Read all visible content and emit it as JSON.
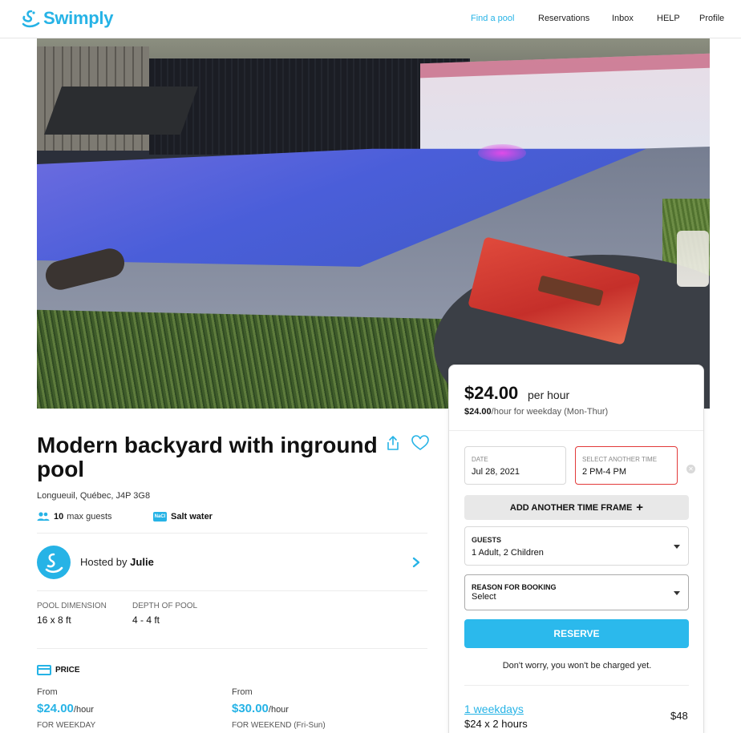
{
  "brand": {
    "name": "Swimply",
    "color": "#26b3e6"
  },
  "nav": {
    "items": [
      {
        "label": "Find a pool",
        "active": true
      },
      {
        "label": "Reservations"
      },
      {
        "label": "Inbox"
      },
      {
        "label": "HELP"
      },
      {
        "label": "Profile"
      }
    ]
  },
  "listing": {
    "title": "Modern backyard with inground pool",
    "address": "Longueuil, Québec, J4P 3G8",
    "features": {
      "guests_count": "10",
      "guests_label": "max guests",
      "water_badge": "NaCl",
      "water_label": "Salt water"
    },
    "host": {
      "prefix": "Hosted by",
      "name": "Julie"
    },
    "dimensions": {
      "pool_label": "POOL DIMENSION",
      "pool_value": "16 x 8 ft",
      "depth_label": "DEPTH OF POOL",
      "depth_value": "4 - 4 ft"
    },
    "pricing": {
      "heading": "PRICE",
      "weekday": {
        "from": "From",
        "price": "$24.00",
        "unit": "/hour",
        "label": "FOR WEEKDAY"
      },
      "weekend": {
        "from": "From",
        "price": "$30.00",
        "unit": "/hour",
        "label": "FOR WEEKEND (Fri-Sun)"
      }
    }
  },
  "booking": {
    "price": "$24.00",
    "per": "per hour",
    "weekday_price": "$24.00",
    "weekday_note": "/hour for weekday (Mon-Thur)",
    "date_label": "DATE",
    "date_value": "Jul 28, 2021",
    "time_label": "SELECT ANOTHER TIME",
    "time_value": "2 PM-4 PM",
    "add_time": "ADD ANOTHER TIME FRAME",
    "guests_label": "GUESTS",
    "guests_value": "1 Adult,  2 Children",
    "reason_label": "REASON FOR BOOKING",
    "reason_value": "Select",
    "reserve": "RESERVE",
    "no_charge": "Don't worry, you won't be charged yet.",
    "breakdown": {
      "label": "1 weekdays",
      "calc": "$24 x 2 hours",
      "total": "$48"
    }
  }
}
